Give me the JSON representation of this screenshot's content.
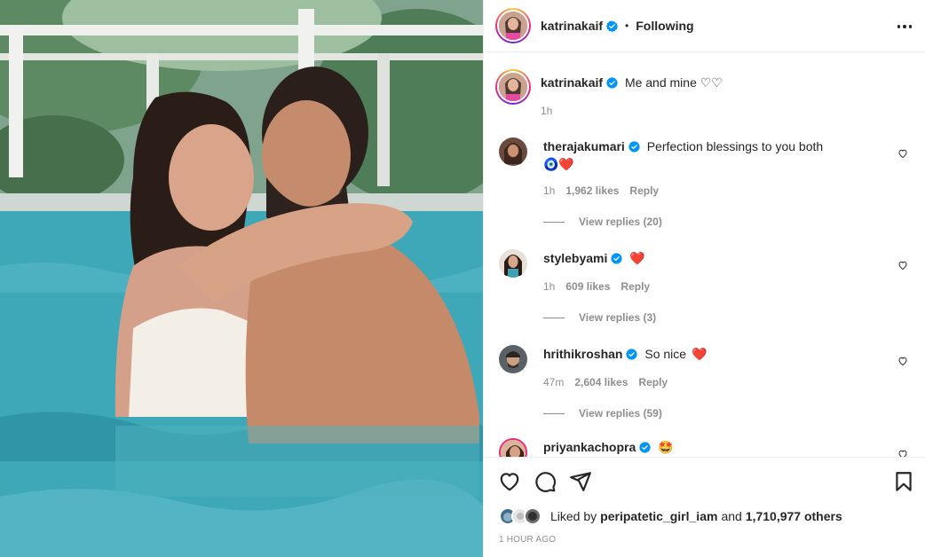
{
  "post": {
    "username": "katrinakaif",
    "follow_status": "Following",
    "caption": "Me and mine ♡♡",
    "caption_time": "1h"
  },
  "comments": [
    {
      "username": "therajakumari",
      "text": "Perfection blessings to you both",
      "extra": "🧿❤️",
      "time": "1h",
      "likes": "1,962 likes",
      "reply": "Reply",
      "view_replies": "View replies (20)"
    },
    {
      "username": "stylebyami",
      "text": "",
      "extra": "❤️",
      "time": "1h",
      "likes": "609 likes",
      "reply": "Reply",
      "view_replies": "View replies (3)"
    },
    {
      "username": "hrithikroshan",
      "text": "So nice",
      "extra": "❤️",
      "time": "47m",
      "likes": "2,604 likes",
      "reply": "Reply",
      "view_replies": "View replies (59)"
    },
    {
      "username": "priyankachopra",
      "text": "",
      "extra": "🤩"
    }
  ],
  "likes": {
    "prefix": "Liked by",
    "user": "peripatetic_girl_iam",
    "and": "and",
    "count": "1,710,977 others"
  },
  "posted": "1 HOUR AGO",
  "icons": {
    "like": "heart-icon",
    "comment": "comment-icon",
    "share": "share-icon",
    "save": "bookmark-icon",
    "more": "more-options-icon",
    "verified": "verified-badge-icon"
  },
  "colors": {
    "verified": "#0095f6",
    "text": "#262626",
    "muted": "#8e8e8e",
    "heart_red": "#ed4956"
  }
}
